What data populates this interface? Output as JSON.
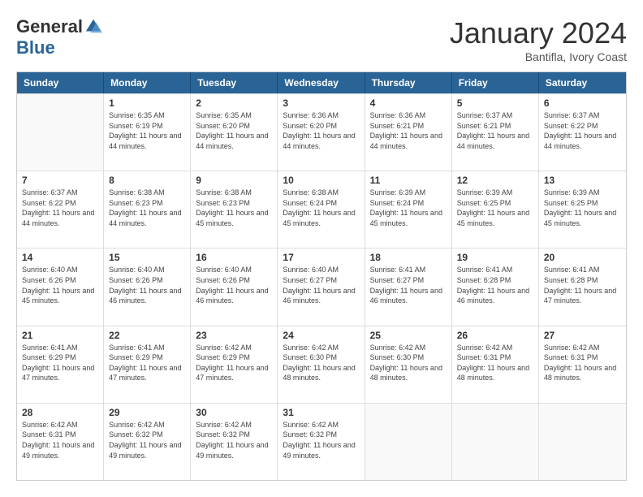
{
  "logo": {
    "general": "General",
    "blue": "Blue"
  },
  "title": "January 2024",
  "subtitle": "Bantifla, Ivory Coast",
  "header_days": [
    "Sunday",
    "Monday",
    "Tuesday",
    "Wednesday",
    "Thursday",
    "Friday",
    "Saturday"
  ],
  "weeks": [
    [
      {
        "day": "",
        "empty": true
      },
      {
        "day": "1",
        "sunrise": "6:35 AM",
        "sunset": "6:19 PM",
        "daylight": "11 hours and 44 minutes."
      },
      {
        "day": "2",
        "sunrise": "6:35 AM",
        "sunset": "6:20 PM",
        "daylight": "11 hours and 44 minutes."
      },
      {
        "day": "3",
        "sunrise": "6:36 AM",
        "sunset": "6:20 PM",
        "daylight": "11 hours and 44 minutes."
      },
      {
        "day": "4",
        "sunrise": "6:36 AM",
        "sunset": "6:21 PM",
        "daylight": "11 hours and 44 minutes."
      },
      {
        "day": "5",
        "sunrise": "6:37 AM",
        "sunset": "6:21 PM",
        "daylight": "11 hours and 44 minutes."
      },
      {
        "day": "6",
        "sunrise": "6:37 AM",
        "sunset": "6:22 PM",
        "daylight": "11 hours and 44 minutes."
      }
    ],
    [
      {
        "day": "7",
        "sunrise": "6:37 AM",
        "sunset": "6:22 PM",
        "daylight": "11 hours and 44 minutes."
      },
      {
        "day": "8",
        "sunrise": "6:38 AM",
        "sunset": "6:23 PM",
        "daylight": "11 hours and 44 minutes."
      },
      {
        "day": "9",
        "sunrise": "6:38 AM",
        "sunset": "6:23 PM",
        "daylight": "11 hours and 45 minutes."
      },
      {
        "day": "10",
        "sunrise": "6:38 AM",
        "sunset": "6:24 PM",
        "daylight": "11 hours and 45 minutes."
      },
      {
        "day": "11",
        "sunrise": "6:39 AM",
        "sunset": "6:24 PM",
        "daylight": "11 hours and 45 minutes."
      },
      {
        "day": "12",
        "sunrise": "6:39 AM",
        "sunset": "6:25 PM",
        "daylight": "11 hours and 45 minutes."
      },
      {
        "day": "13",
        "sunrise": "6:39 AM",
        "sunset": "6:25 PM",
        "daylight": "11 hours and 45 minutes."
      }
    ],
    [
      {
        "day": "14",
        "sunrise": "6:40 AM",
        "sunset": "6:26 PM",
        "daylight": "11 hours and 45 minutes."
      },
      {
        "day": "15",
        "sunrise": "6:40 AM",
        "sunset": "6:26 PM",
        "daylight": "11 hours and 46 minutes."
      },
      {
        "day": "16",
        "sunrise": "6:40 AM",
        "sunset": "6:26 PM",
        "daylight": "11 hours and 46 minutes."
      },
      {
        "day": "17",
        "sunrise": "6:40 AM",
        "sunset": "6:27 PM",
        "daylight": "11 hours and 46 minutes."
      },
      {
        "day": "18",
        "sunrise": "6:41 AM",
        "sunset": "6:27 PM",
        "daylight": "11 hours and 46 minutes."
      },
      {
        "day": "19",
        "sunrise": "6:41 AM",
        "sunset": "6:28 PM",
        "daylight": "11 hours and 46 minutes."
      },
      {
        "day": "20",
        "sunrise": "6:41 AM",
        "sunset": "6:28 PM",
        "daylight": "11 hours and 47 minutes."
      }
    ],
    [
      {
        "day": "21",
        "sunrise": "6:41 AM",
        "sunset": "6:29 PM",
        "daylight": "11 hours and 47 minutes."
      },
      {
        "day": "22",
        "sunrise": "6:41 AM",
        "sunset": "6:29 PM",
        "daylight": "11 hours and 47 minutes."
      },
      {
        "day": "23",
        "sunrise": "6:42 AM",
        "sunset": "6:29 PM",
        "daylight": "11 hours and 47 minutes."
      },
      {
        "day": "24",
        "sunrise": "6:42 AM",
        "sunset": "6:30 PM",
        "daylight": "11 hours and 48 minutes."
      },
      {
        "day": "25",
        "sunrise": "6:42 AM",
        "sunset": "6:30 PM",
        "daylight": "11 hours and 48 minutes."
      },
      {
        "day": "26",
        "sunrise": "6:42 AM",
        "sunset": "6:31 PM",
        "daylight": "11 hours and 48 minutes."
      },
      {
        "day": "27",
        "sunrise": "6:42 AM",
        "sunset": "6:31 PM",
        "daylight": "11 hours and 48 minutes."
      }
    ],
    [
      {
        "day": "28",
        "sunrise": "6:42 AM",
        "sunset": "6:31 PM",
        "daylight": "11 hours and 49 minutes."
      },
      {
        "day": "29",
        "sunrise": "6:42 AM",
        "sunset": "6:32 PM",
        "daylight": "11 hours and 49 minutes."
      },
      {
        "day": "30",
        "sunrise": "6:42 AM",
        "sunset": "6:32 PM",
        "daylight": "11 hours and 49 minutes."
      },
      {
        "day": "31",
        "sunrise": "6:42 AM",
        "sunset": "6:32 PM",
        "daylight": "11 hours and 49 minutes."
      },
      {
        "day": "",
        "empty": true
      },
      {
        "day": "",
        "empty": true
      },
      {
        "day": "",
        "empty": true
      }
    ]
  ]
}
